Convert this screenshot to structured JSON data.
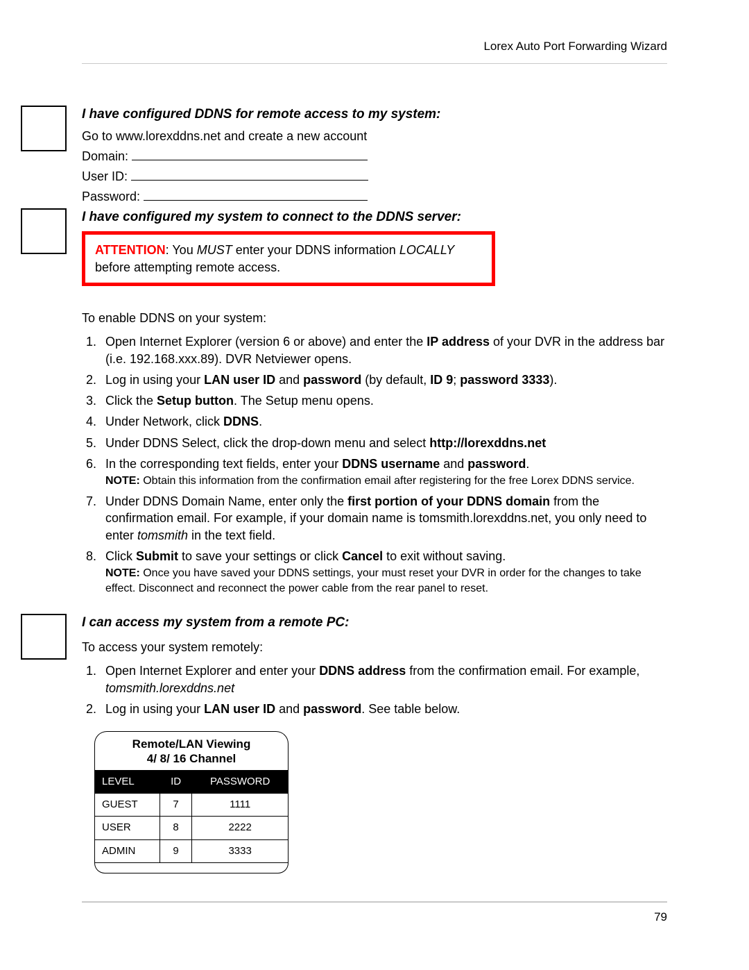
{
  "header": "Lorex Auto Port Forwarding Wizard",
  "page_number": "79",
  "section1": {
    "title": "I have configured DDNS for remote access to my system:",
    "goto": "Go to www.lorexddns.net and create a new account",
    "domain_label": "Domain:",
    "userid_label": "User ID:",
    "password_label": "Password:"
  },
  "section2": {
    "title": "I have configured my system to connect to the DDNS server:",
    "attention_word": "ATTENTION",
    "attention_sep": ": You ",
    "attention_must": "MUST",
    "attention_mid": " enter your DDNS information ",
    "attention_locally": "LOCALLY",
    "attention_end": " before attempting remote access.",
    "enable_intro": "To enable DDNS on your system:",
    "steps": {
      "s1a": "Open Internet Explorer (version 6 or above) and enter the ",
      "s1b": "IP address",
      "s1c": " of your DVR in the address bar (i.e. 192.168.xxx.89). DVR Netviewer opens.",
      "s2a": "Log in using your ",
      "s2b": "LAN user ID",
      "s2c": " and ",
      "s2d": "password",
      "s2e": " (by default, ",
      "s2f": "ID 9",
      "s2g": "; ",
      "s2h": "password 3333",
      "s2i": ").",
      "s3a": "Click the ",
      "s3b": "Setup button",
      "s3c": ". The Setup menu opens.",
      "s4a": "Under Network, click ",
      "s4b": "DDNS",
      "s4c": ".",
      "s5a": "Under DDNS Select, click the drop-down menu and select ",
      "s5b": "http://lorexddns.net",
      "s6a": "In the corresponding text fields, enter your ",
      "s6b": "DDNS username",
      "s6c": " and ",
      "s6d": "password",
      "s6e": ".",
      "s6note_label": "NOTE:",
      "s6note": " Obtain this information from the confirmation email after registering for the free Lorex DDNS service.",
      "s7a": "Under DDNS Domain Name, enter only the ",
      "s7b": "first portion of your DDNS domain",
      "s7c": " from the confirmation email. For example, if your domain name is tomsmith.lorexddns.net, you only need to enter ",
      "s7d": "tomsmith",
      "s7e": " in the text field.",
      "s8a": "Click ",
      "s8b": "Submit",
      "s8c": " to save your settings or click ",
      "s8d": "Cancel",
      "s8e": " to exit without saving.",
      "s8note_label": "NOTE:",
      "s8note": " Once you have saved your DDNS settings, your must reset your DVR in order for the changes to take effect. Disconnect and reconnect the power cable from the rear panel to reset."
    }
  },
  "section3": {
    "title": "I can access my system from a remote PC:",
    "intro": "To access your system remotely:",
    "steps": {
      "s1a": "Open Internet Explorer and enter your ",
      "s1b": "DDNS address",
      "s1c": " from the confirmation email. For example, ",
      "s1d": "tomsmith.lorexddns.net",
      "s2a": "Log in using your ",
      "s2b": "LAN user ID",
      "s2c": " and ",
      "s2d": "password",
      "s2e": ". See table below."
    }
  },
  "table": {
    "title_line1": "Remote/LAN Viewing",
    "title_line2": "4/ 8/ 16 Channel",
    "headers": {
      "level": "LEVEL",
      "id": "ID",
      "password": "PASSWORD"
    },
    "rows": [
      {
        "level": "GUEST",
        "id": "7",
        "password": "1111"
      },
      {
        "level": "USER",
        "id": "8",
        "password": "2222"
      },
      {
        "level": "ADMIN",
        "id": "9",
        "password": "3333"
      }
    ]
  }
}
